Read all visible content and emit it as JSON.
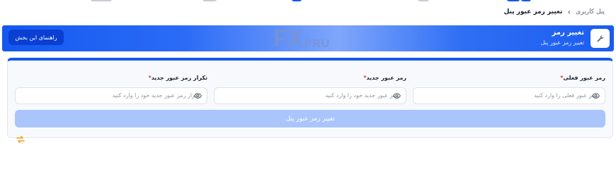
{
  "breadcrumb": {
    "parent": "پنل کاربری",
    "separator": "›",
    "current": "تغییر رمز عبور پنل"
  },
  "banner": {
    "title": "تغییر رمز",
    "subtitle": "تغییر رمز عبور پنل",
    "guide_button": "راهنمای این بخش",
    "watermark_main": "FX",
    "watermark_sub": "PRU",
    "icon": "wrench-icon"
  },
  "form": {
    "current_password": {
      "label": "رمز عبور فعلی",
      "required_mark": "*",
      "placeholder": "رمز عبور فعلی را وارد کنید"
    },
    "new_password": {
      "label": "رمز عبور جدید",
      "required_mark": "*",
      "placeholder": "رمز عبور جدید خود را وارد کنید"
    },
    "confirm_password": {
      "label": "تکرار رمز عبور جدید",
      "required_mark": "*",
      "placeholder": "تکرار رمز عبور جدید خود را وارد کنید"
    },
    "submit_label": "تغییر رمز عبور پنل"
  },
  "colors": {
    "accent": "#1558f0",
    "button_disabled": "#aac5fb",
    "guide_button": "#0a3fd2",
    "required": "#e53935"
  }
}
